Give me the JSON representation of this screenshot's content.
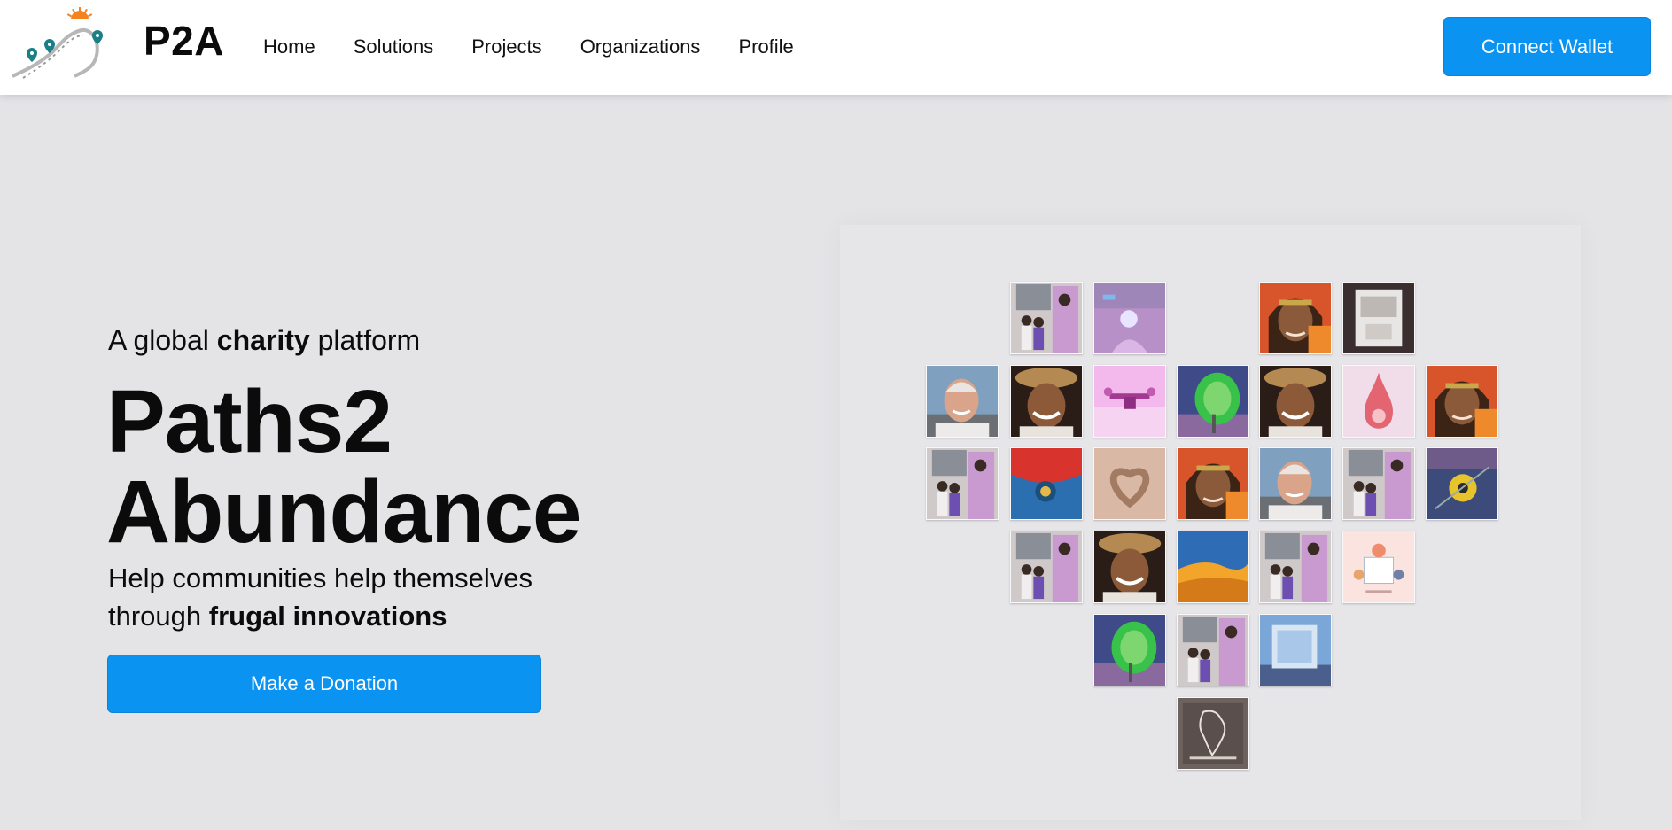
{
  "header": {
    "brand": "P2A",
    "nav": [
      {
        "label": "Home"
      },
      {
        "label": "Solutions"
      },
      {
        "label": "Projects"
      },
      {
        "label": "Organizations"
      },
      {
        "label": "Profile"
      }
    ],
    "connect_wallet_label": "Connect Wallet",
    "logo_icon": "winding-road-logo-icon"
  },
  "hero": {
    "tagline_pre": "A global",
    "tagline_bold": "charity",
    "tagline_post": "platform",
    "title_line1": "Paths2",
    "title_line2": "Abundance",
    "subtitle_line1": "Help communities help themselves",
    "subtitle_line2_pre": "through",
    "subtitle_line2_bold": "frugal innovations",
    "donate_label": "Make a Donation"
  },
  "colors": {
    "accent": "#0a93f1",
    "page_background": "#e4e4e7",
    "header_background": "#ffffff"
  },
  "collage": {
    "description_visible": false,
    "tiles": [
      {
        "kind": "family-photo"
      },
      {
        "kind": "lamp-photo"
      },
      {
        "kind": "woman-photo"
      },
      {
        "kind": "device-photo"
      },
      {
        "kind": "old-man-photo"
      },
      {
        "kind": "boy-hat-photo"
      },
      {
        "kind": "drone-photo"
      },
      {
        "kind": "solar-dish-photo"
      },
      {
        "kind": "boy-hat-photo"
      },
      {
        "kind": "pink-sketch-photo"
      },
      {
        "kind": "woman-photo"
      },
      {
        "kind": "family-photo"
      },
      {
        "kind": "blue-tarp-photo"
      },
      {
        "kind": "hands-heart-photo"
      },
      {
        "kind": "woman-photo"
      },
      {
        "kind": "old-man-photo"
      },
      {
        "kind": "family-photo"
      },
      {
        "kind": "yellow-disc-photo"
      },
      {
        "kind": "family-photo"
      },
      {
        "kind": "boy-hat-photo"
      },
      {
        "kind": "orange-blue-photo"
      },
      {
        "kind": "family-photo"
      },
      {
        "kind": "illustration-card"
      },
      {
        "kind": "solar-dish-photo"
      },
      {
        "kind": "family-photo"
      },
      {
        "kind": "water-tank-photo"
      },
      {
        "kind": "charity-logo-card"
      }
    ]
  }
}
